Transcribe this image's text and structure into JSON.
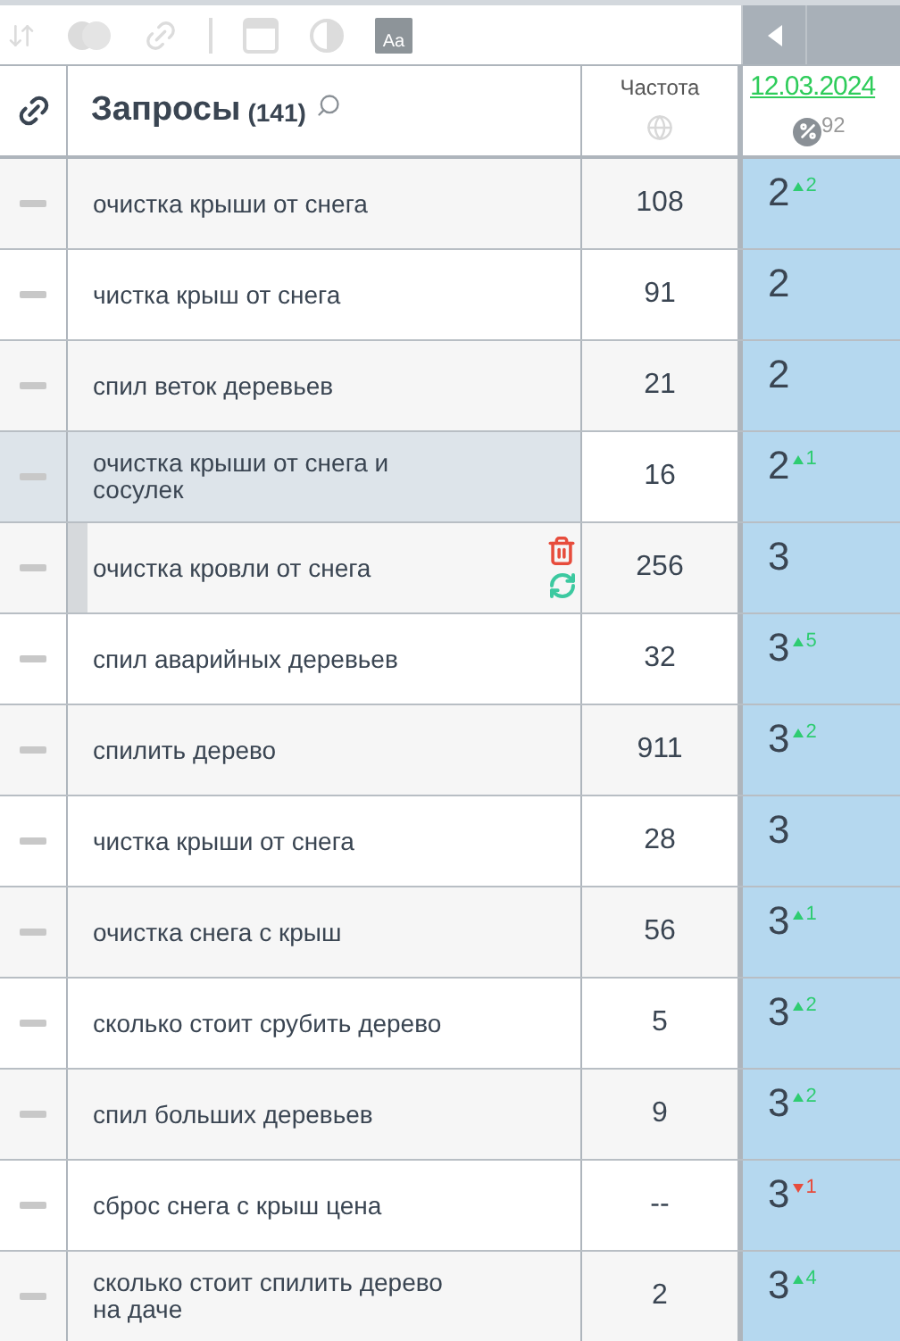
{
  "toolbar": {
    "font_button": "Aa"
  },
  "header": {
    "title": "Запросы",
    "count": "(141)",
    "frequency": "Частота",
    "date": "12.03.2024",
    "percent": "92"
  },
  "rows": [
    {
      "query": "очистка крыши от снега",
      "frequency": "108",
      "position_shown": "2",
      "change": {
        "kind": "up",
        "value": "2"
      },
      "highlighted": false,
      "hovered": false
    },
    {
      "query": "чистка крыш от снега",
      "frequency": "91",
      "position_shown": "2",
      "highlighted": false,
      "hovered": false
    },
    {
      "query": "спил веток деревьев",
      "frequency": "21",
      "position_shown": "2",
      "highlighted": false,
      "hovered": false
    },
    {
      "query": "очистка крыши от снега и сосулек",
      "frequency": "16",
      "position_shown": "2",
      "change": {
        "kind": "up",
        "value": "1"
      },
      "highlighted": true,
      "hovered": false
    },
    {
      "query": "очистка кровли от снега",
      "frequency": "256",
      "position_shown": "3",
      "highlighted": false,
      "hovered": true
    },
    {
      "query": "спил аварийных деревьев",
      "frequency": "32",
      "position_shown": "3",
      "change": {
        "kind": "up",
        "value": "5"
      },
      "highlighted": false,
      "hovered": false
    },
    {
      "query": "спилить дерево",
      "frequency": "911",
      "position_shown": "3",
      "change": {
        "kind": "up",
        "value": "2"
      },
      "highlighted": false,
      "hovered": false
    },
    {
      "query": "чистка крыши от снега",
      "frequency": "28",
      "position_shown": "3",
      "highlighted": false,
      "hovered": false
    },
    {
      "query": "очистка снега с крыш",
      "frequency": "56",
      "position_shown": "3",
      "change": {
        "kind": "up",
        "value": "1"
      },
      "highlighted": false,
      "hovered": false
    },
    {
      "query": "сколько стоит срубить дерево",
      "frequency": "5",
      "position_shown": "3",
      "change": {
        "kind": "up",
        "value": "2"
      },
      "highlighted": false,
      "hovered": false
    },
    {
      "query": "спил больших деревьев",
      "frequency": "9",
      "position_shown": "3",
      "change": {
        "kind": "up",
        "value": "2"
      },
      "highlighted": false,
      "hovered": false
    },
    {
      "query": "сброс снега с крыш цена",
      "frequency": "--",
      "position_shown": "3",
      "change": {
        "kind": "down",
        "value": "1"
      },
      "highlighted": false,
      "hovered": false
    },
    {
      "query": "сколько стоит спилить дерево на даче",
      "frequency": "2",
      "position_shown": "3",
      "change": {
        "kind": "up",
        "value": "4"
      },
      "highlighted": false,
      "hovered": false
    }
  ]
}
